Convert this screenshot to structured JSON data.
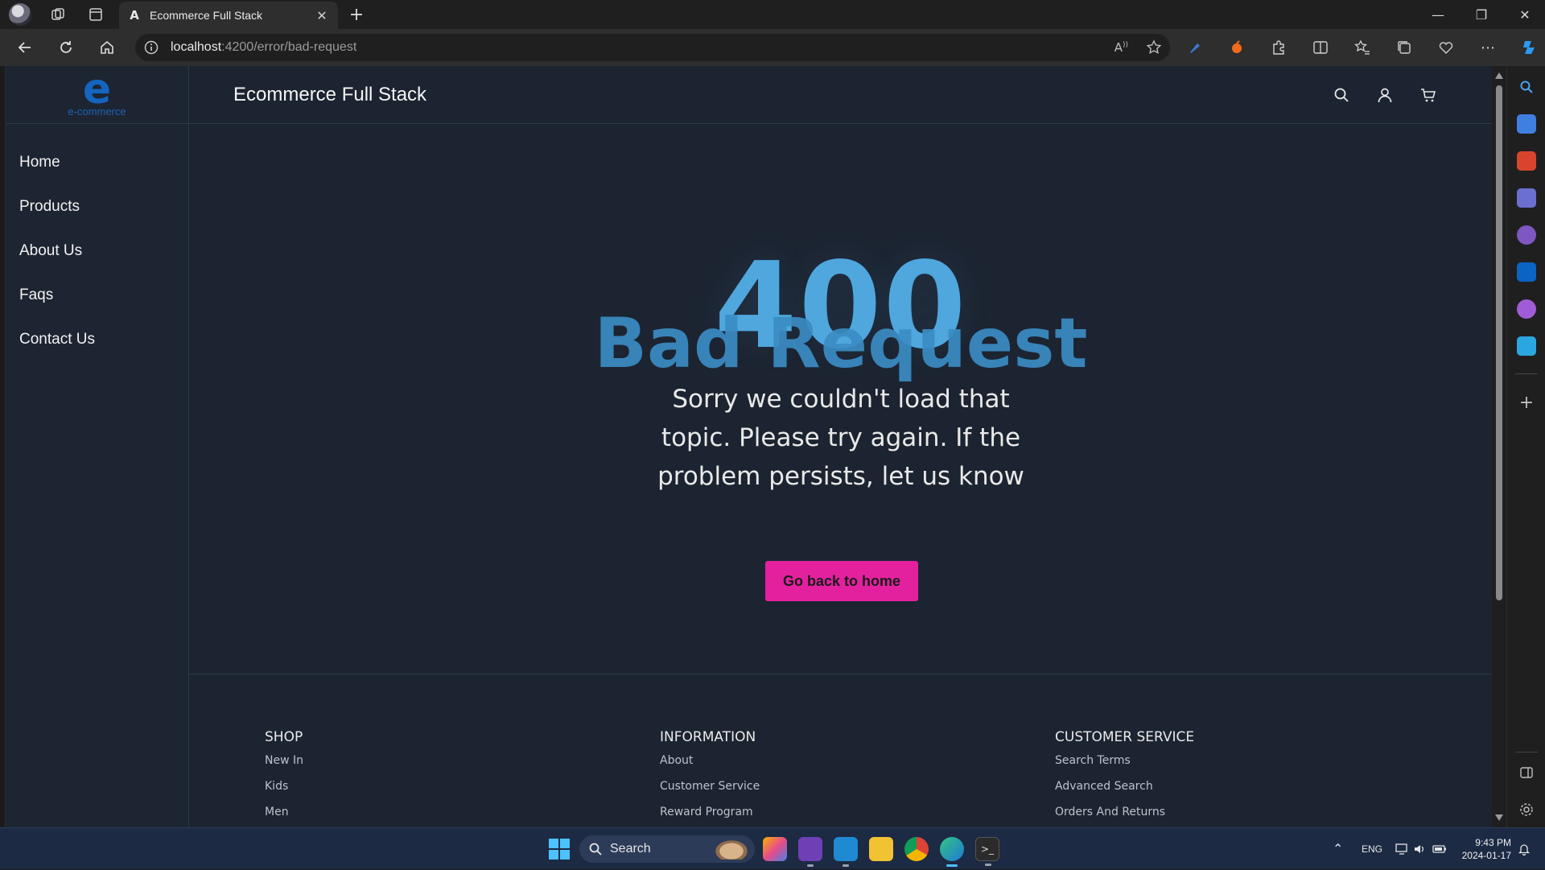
{
  "browser": {
    "tab_title": "Ecommerce Full Stack",
    "tab_favicon": "A",
    "url_host": "localhost",
    "url_path": ":4200/error/bad-request"
  },
  "sidebar": {
    "logo_text": "e-commerce",
    "items": [
      {
        "label": "Home"
      },
      {
        "label": "Products"
      },
      {
        "label": "About Us"
      },
      {
        "label": "Faqs"
      },
      {
        "label": "Contact Us"
      }
    ]
  },
  "header": {
    "brand": "Ecommerce Full Stack"
  },
  "error": {
    "code": "400",
    "title": "Bad Request",
    "message": "Sorry we couldn't load that topic. Please try again. If the problem persists, let us know",
    "button_label": "Go back to home"
  },
  "footer": {
    "columns": [
      {
        "heading": "SHOP",
        "links": [
          "New In",
          "Kids",
          "Men"
        ]
      },
      {
        "heading": "INFORMATION",
        "links": [
          "About",
          "Customer Service",
          "Reward Program"
        ]
      },
      {
        "heading": "CUSTOMER SERVICE",
        "links": [
          "Search Terms",
          "Advanced Search",
          "Orders And Returns"
        ]
      }
    ]
  },
  "taskbar": {
    "search_label": "Search",
    "language": "ENG",
    "time": "9:43 PM",
    "date": "2024-01-17"
  },
  "colors": {
    "page_bg": "#1c2431",
    "accent_button": "#e3219f",
    "error_code": "#4fa7de",
    "error_title": "#3b8cc3",
    "logo": "#1565c0"
  },
  "icons": {
    "header": [
      "search-icon",
      "user-icon",
      "cart-icon"
    ]
  }
}
